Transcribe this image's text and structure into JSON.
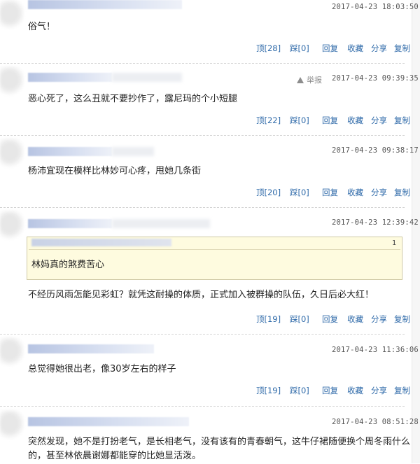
{
  "comments": [
    {
      "timestamp": "2017-04-23 18:03:50",
      "text": "俗气！",
      "actions": {
        "up": "顶[28]",
        "down": "踩[0]",
        "reply": "回复",
        "fav": "收藏",
        "share": "分享",
        "copy": "复制"
      }
    },
    {
      "report": "举报",
      "timestamp": "2017-04-23 09:39:35",
      "text": "恶心死了，这么丑就不要抄作了，露尼玛的个小短腿",
      "actions": {
        "up": "顶[22]",
        "down": "踩[0]",
        "reply": "回复",
        "fav": "收藏",
        "share": "分享",
        "copy": "复制"
      }
    },
    {
      "timestamp": "2017-04-23 09:38:17",
      "text": "杨沛宜现在模样比林妙可心疼，甩她几条街",
      "actions": {
        "up": "顶[20]",
        "down": "踩[0]",
        "reply": "回复",
        "fav": "收藏",
        "share": "分享",
        "copy": "复制"
      }
    },
    {
      "timestamp": "2017-04-23 12:39:42",
      "quote": {
        "floor": "1",
        "text": "林妈真的煞费苦心"
      },
      "text": "不经历风雨怎能见彩虹？就凭这耐操的体质，正式加入被群操的队伍，久日后必大红！",
      "actions": {
        "up": "顶[19]",
        "down": "踩[0]",
        "reply": "回复",
        "fav": "收藏",
        "share": "分享",
        "copy": "复制"
      }
    },
    {
      "timestamp": "2017-04-23 11:36:06",
      "text": "总觉得她很出老，像30岁左右的样子",
      "actions": {
        "up": "顶[19]",
        "down": "踩[0]",
        "reply": "回复",
        "fav": "收藏",
        "share": "分享",
        "copy": "复制"
      }
    },
    {
      "timestamp": "2017-04-23 08:51:28",
      "text_line1": "突然发现，她不是打扮老气，是长相老气，没有该有的青春朝气，这牛仔裙随便换个周冬雨什么",
      "text_line2": "的，甚至林依晨谢娜都能穿的比她显活泼。"
    }
  ]
}
